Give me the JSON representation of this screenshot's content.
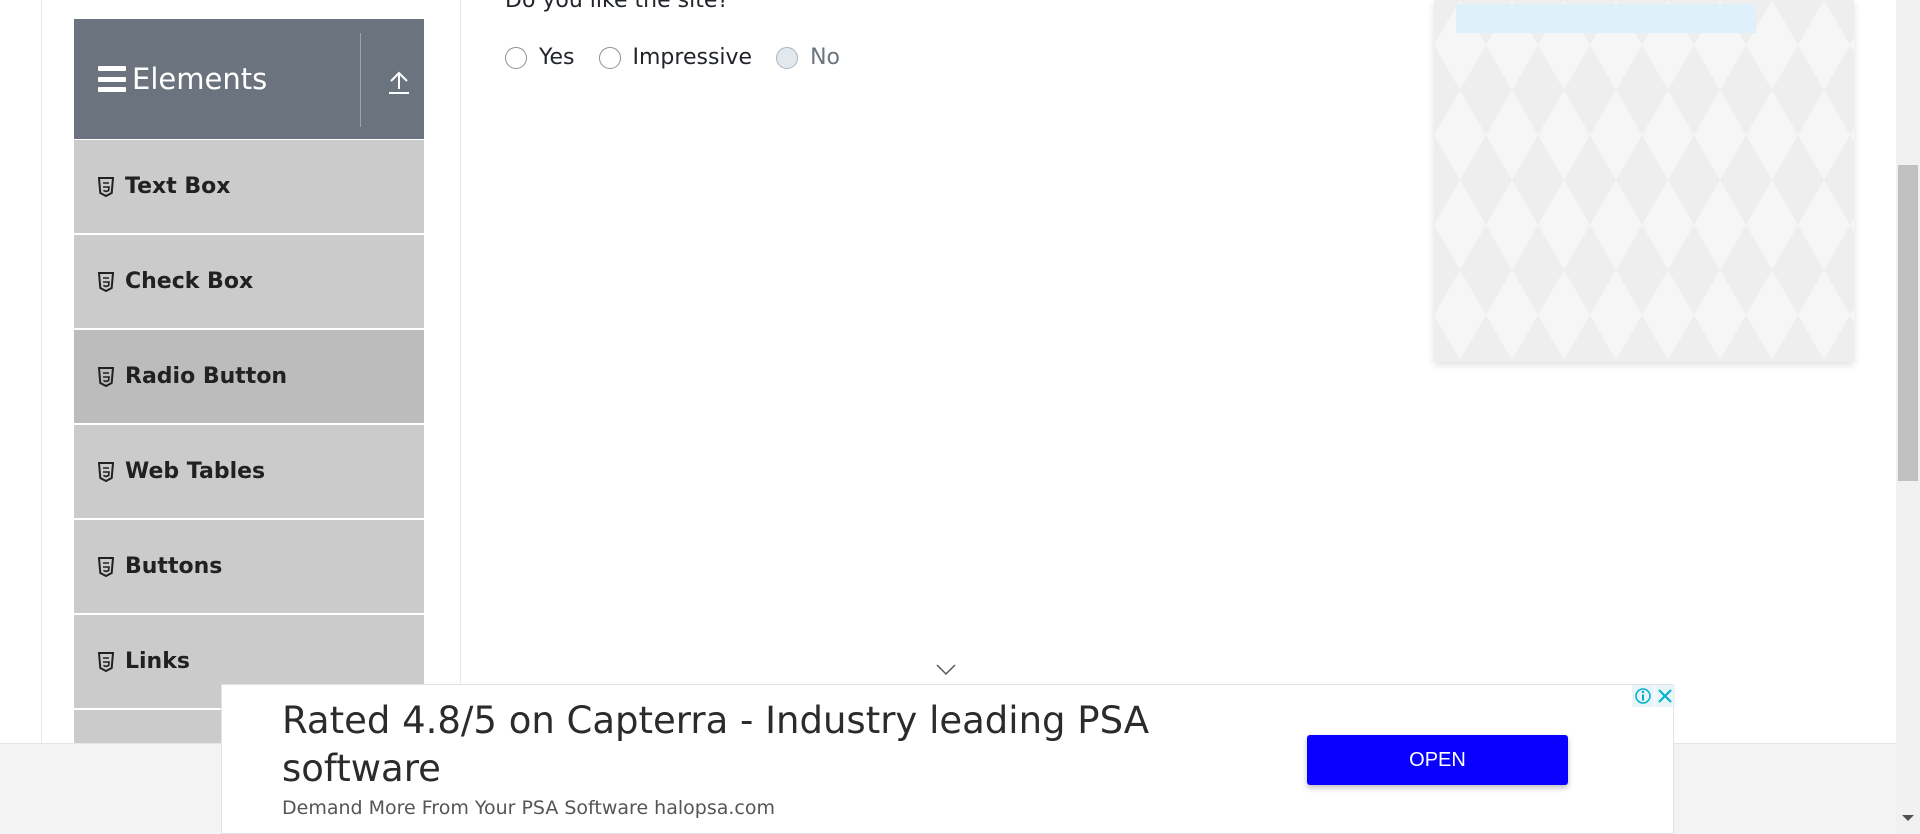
{
  "sidebar": {
    "group_title": "Elements",
    "items": [
      {
        "label": "Text Box"
      },
      {
        "label": "Check Box"
      },
      {
        "label": "Radio Button"
      },
      {
        "label": "Web Tables"
      },
      {
        "label": "Buttons"
      },
      {
        "label": "Links"
      }
    ]
  },
  "form": {
    "question": "Do you like the site?",
    "options": [
      {
        "label": "Yes",
        "disabled": false
      },
      {
        "label": "Impressive",
        "disabled": false
      },
      {
        "label": "No",
        "disabled": true
      }
    ]
  },
  "ad_banner": {
    "headline": "Rated 4.8/5 on Capterra - Industry leading PSA software",
    "subtext": "Demand More From Your PSA Software halopsa.com",
    "button_label": "OPEN"
  },
  "colors": {
    "sidebar_header": "#6b747e",
    "menu_item": "#cbcbcb",
    "menu_item_active": "#bcbcbc",
    "ad_button": "#0a00ff"
  }
}
